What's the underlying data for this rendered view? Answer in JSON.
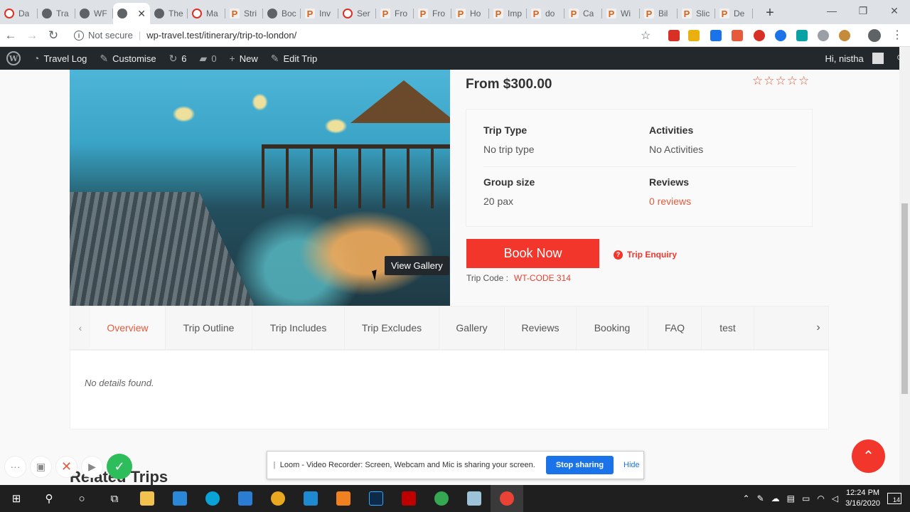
{
  "browser": {
    "tabs": [
      {
        "title": "Da",
        "favicon": "opera-icon"
      },
      {
        "title": "Tra",
        "favicon": "globe-icon"
      },
      {
        "title": "WF",
        "favicon": "globe-icon"
      },
      {
        "title": "",
        "favicon": "globe-icon",
        "active": true
      },
      {
        "title": "The",
        "favicon": "globe-icon"
      },
      {
        "title": "Ma",
        "favicon": "opera-icon"
      },
      {
        "title": "Stri",
        "favicon": "p-icon"
      },
      {
        "title": "Boc",
        "favicon": "globe-icon"
      },
      {
        "title": "Inv",
        "favicon": "p-icon"
      },
      {
        "title": "Ser",
        "favicon": "opera-icon"
      },
      {
        "title": "Fro",
        "favicon": "p-icon"
      },
      {
        "title": "Fro",
        "favicon": "p-icon"
      },
      {
        "title": "Ho",
        "favicon": "p-icon"
      },
      {
        "title": "Imp",
        "favicon": "p-icon"
      },
      {
        "title": "do",
        "favicon": "p-icon"
      },
      {
        "title": "Ca",
        "favicon": "p-icon"
      },
      {
        "title": "Wi",
        "favicon": "p-icon"
      },
      {
        "title": "Bil",
        "favicon": "p-icon"
      },
      {
        "title": "Slic",
        "favicon": "p-icon"
      },
      {
        "title": "De",
        "favicon": "p-icon"
      }
    ],
    "not_secure": "Not secure",
    "url": "wp-travel.test/itinerary/trip-to-london/"
  },
  "adminbar": {
    "site_name": "Travel Log",
    "customise": "Customise",
    "updates": "6",
    "comments": "0",
    "new": "New",
    "edit": "Edit Trip",
    "greeting": "Hi, nistha"
  },
  "trip": {
    "view_gallery": "View Gallery",
    "price": "From $300.00",
    "rating_stars": "☆☆☆☆☆",
    "trip_type_label": "Trip Type",
    "trip_type_value": "No trip type",
    "activities_label": "Activities",
    "activities_value": "No Activities",
    "group_size_label": "Group size",
    "group_size_value": "20 pax",
    "reviews_label": "Reviews",
    "reviews_value": "0 reviews",
    "book_now": "Book Now",
    "enquiry": "Trip Enquiry",
    "trip_code_label": "Trip Code :",
    "trip_code": "WT-CODE 314"
  },
  "tabs": [
    "Overview",
    "Trip Outline",
    "Trip Includes",
    "Trip Excludes",
    "Gallery",
    "Reviews",
    "Booking",
    "FAQ",
    "test"
  ],
  "tab_content": "No details found.",
  "related_heading": "Related Trips",
  "loom": {
    "message": "Loom - Video Recorder: Screen, Webcam and Mic is sharing your screen.",
    "stop": "Stop sharing",
    "hide": "Hide"
  },
  "taskbar": {
    "time": "12:24 PM",
    "date": "3/16/2020",
    "notifications": "14"
  },
  "colors": {
    "accent": "#f2362b",
    "link": "#e55b3b",
    "adminbar": "#23282d"
  }
}
